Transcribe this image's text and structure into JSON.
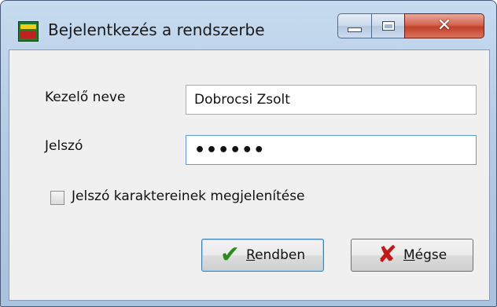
{
  "window": {
    "title": "Bejelentkezés a rendszerbe",
    "app_icon": "app-logo-icon",
    "controls": {
      "minimize": "minimize-icon",
      "maximize": "maximize-icon",
      "close": "close-icon"
    }
  },
  "form": {
    "operator_label": "Kezelő neve",
    "operator_value": "Dobrocsi Zsolt",
    "password_label": "Jelszó",
    "password_value": "••••••",
    "show_password_label": "Jelszó karaktereinek megjelenítése",
    "show_password_checked": false
  },
  "buttons": {
    "ok": {
      "accel": "R",
      "rest": "endben",
      "icon": "checkmark-icon"
    },
    "cancel": {
      "accel": "M",
      "rest": "égse",
      "icon": "x-icon"
    }
  },
  "colors": {
    "ok_check": "#2e8b20",
    "cancel_x": "#c21919",
    "close_button": "#c2402a"
  }
}
